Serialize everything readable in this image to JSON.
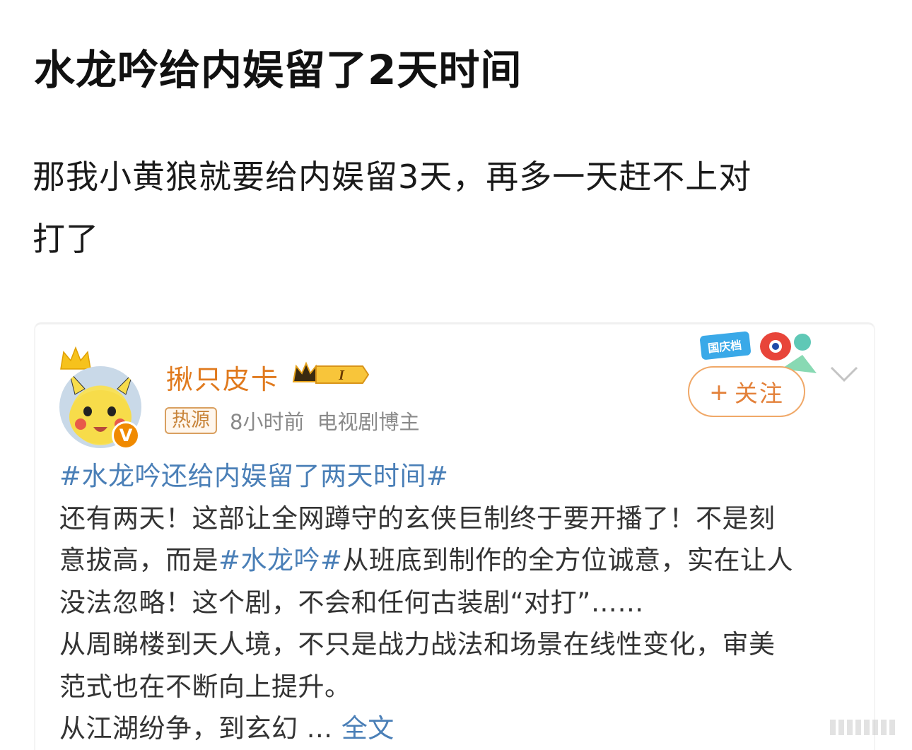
{
  "post": {
    "title": "水龙吟给内娱留了2天时间",
    "body_line1": "那我小黄狼就要给内娱留3天，再多一天赶不上对",
    "body_line2": "打了"
  },
  "quoted": {
    "author": "揪只皮卡",
    "vip_label": "I",
    "hot_tag": "热源",
    "time": "8小时前",
    "role": "电视剧博主",
    "follow_label": "关注",
    "follow_plus": "+",
    "event_sticker_text": "国庆档",
    "verified_mark": "V",
    "hashtag_title": "#水龙吟还给内娱留了两天时间#",
    "line1": "还有两天！这部让全网蹲守的玄侠巨制终于要开播了！不是刻",
    "line2_a": "意拔高，而是",
    "line2_tag": "#水龙吟#",
    "line2_b": "从班底到制作的全方位诚意，实在让人",
    "line3": "没法忽略！这个剧，不会和任何古装剧“对打”……",
    "line4": "从周睇楼到天人境，不只是战力战法和场景在线性变化，审美",
    "line5": "范式也在不断向上提升。",
    "line6": "从江湖纷争，到玄幻 ... ",
    "more_label": "全文"
  },
  "colors": {
    "author_orange": "#e07a1e",
    "link_blue": "#4a7fb7",
    "follow_border": "#f0a868"
  }
}
